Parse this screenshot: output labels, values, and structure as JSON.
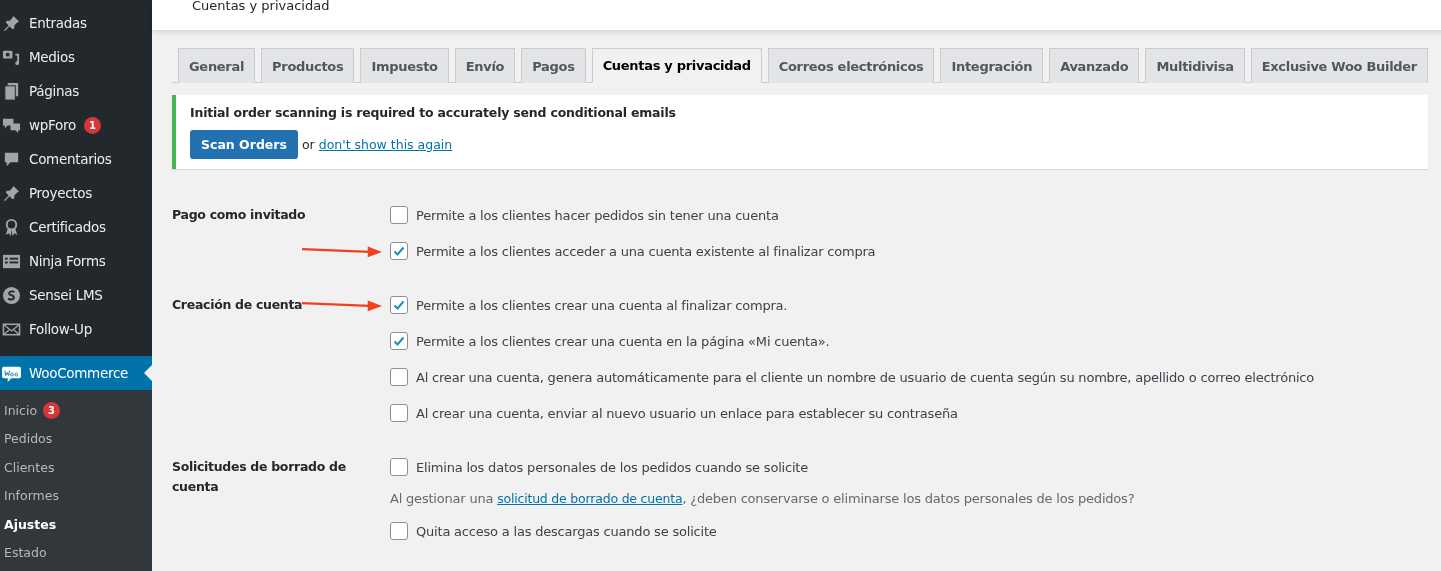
{
  "sidebar": {
    "items": [
      {
        "label": "Entradas",
        "selected": false
      },
      {
        "label": "Medios",
        "selected": false
      },
      {
        "label": "Páginas",
        "selected": false
      },
      {
        "label": "wpForo",
        "badge": "1",
        "selected": false
      },
      {
        "label": "Comentarios",
        "selected": false
      },
      {
        "label": "Proyectos",
        "selected": false
      },
      {
        "label": "Certificados",
        "selected": false
      },
      {
        "label": "Ninja Forms",
        "selected": false
      },
      {
        "label": "Sensei LMS",
        "selected": false
      },
      {
        "label": "Follow-Up",
        "selected": false
      },
      {
        "label": "WooCommerce",
        "selected": true
      }
    ],
    "submenu": [
      {
        "label": "Inicio",
        "badge": "3",
        "selected": false
      },
      {
        "label": "Pedidos",
        "selected": false
      },
      {
        "label": "Clientes",
        "selected": false
      },
      {
        "label": "Informes",
        "selected": false
      },
      {
        "label": "Ajustes",
        "selected": true
      },
      {
        "label": "Estado",
        "selected": false
      }
    ]
  },
  "header": {
    "title": "Cuentas y privacidad"
  },
  "tabs": [
    {
      "label": "General",
      "selected": false
    },
    {
      "label": "Productos",
      "selected": false
    },
    {
      "label": "Impuesto",
      "selected": false
    },
    {
      "label": "Envío",
      "selected": false
    },
    {
      "label": "Pagos",
      "selected": false
    },
    {
      "label": "Cuentas y privacidad",
      "selected": true
    },
    {
      "label": "Correos electrónicos",
      "selected": false
    },
    {
      "label": "Integración",
      "selected": false
    },
    {
      "label": "Avanzado",
      "selected": false
    },
    {
      "label": "Multidivisa",
      "selected": false
    },
    {
      "label": "Exclusive Woo Builder",
      "selected": false
    }
  ],
  "notice": {
    "message": "Initial order scanning is required to accurately send conditional emails",
    "button": "Scan Orders",
    "or": "or",
    "link": "don't show this again"
  },
  "sections": [
    {
      "label": "Pago como invitado",
      "options": [
        {
          "kind": "checkbox",
          "label": "Permite a los clientes hacer pedidos sin tener una cuenta",
          "checked": false,
          "annotated": false
        },
        {
          "kind": "checkbox",
          "label": "Permite a los clientes acceder a una cuenta existente al finalizar compra",
          "checked": true,
          "annotated": true
        }
      ]
    },
    {
      "label": "Creación de cuenta",
      "options": [
        {
          "kind": "checkbox",
          "label": "Permite a los clientes crear una cuenta al finalizar compra.",
          "checked": true,
          "annotated": true
        },
        {
          "kind": "checkbox",
          "label": "Permite a los clientes crear una cuenta en la página «Mi cuenta».",
          "checked": true,
          "annotated": false
        },
        {
          "kind": "checkbox",
          "label": "Al crear una cuenta, genera automáticamente para el cliente un nombre de usuario de cuenta según su nombre, apellido o correo electrónico",
          "checked": false,
          "annotated": false
        },
        {
          "kind": "checkbox",
          "label": "Al crear una cuenta, enviar al nuevo usuario un enlace para establecer su contraseña",
          "checked": false,
          "annotated": false
        }
      ]
    },
    {
      "label": "Solicitudes de borrado de cuenta",
      "options": [
        {
          "kind": "checkbox",
          "label": "Elimina los datos personales de los pedidos cuando se solicite",
          "checked": false,
          "annotated": false
        },
        {
          "kind": "description",
          "before": "Al gestionar una",
          "link": "solicitud de borrado de cuenta",
          "after": ", ¿deben conservarse o eliminarse los datos personales de los pedidos?"
        },
        {
          "kind": "checkbox",
          "label": "Quita acceso a las descargas cuando se solicite",
          "checked": false,
          "annotated": false
        }
      ]
    }
  ]
}
